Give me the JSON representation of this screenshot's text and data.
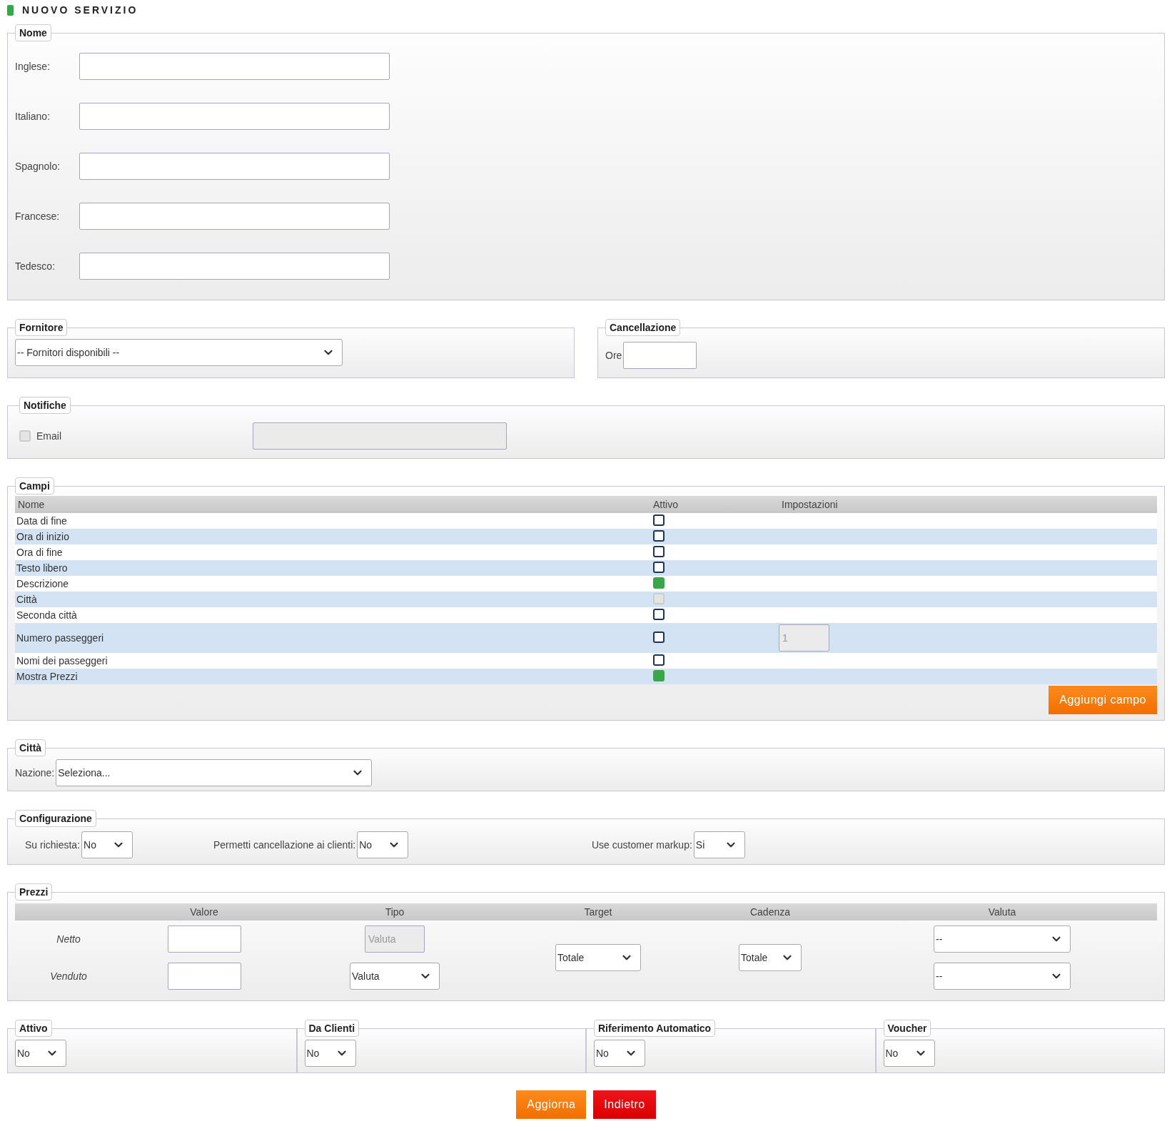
{
  "title": "NUOVO SERVIZIO",
  "nome": {
    "legend": "Nome",
    "fields": [
      {
        "label": "Inglese:"
      },
      {
        "label": "Italiano:"
      },
      {
        "label": "Spagnolo:"
      },
      {
        "label": "Francese:"
      },
      {
        "label": "Tedesco:"
      }
    ]
  },
  "fornitore": {
    "legend": "Fornitore",
    "select": "-- Fornitori disponibili --"
  },
  "cancellazione": {
    "legend": "Cancellazione",
    "label": "Ore"
  },
  "notifiche": {
    "legend": "Notifiche",
    "email": {
      "label": "Email",
      "checked": false,
      "disabled": true
    }
  },
  "campi": {
    "legend": "Campi",
    "columns": [
      "Nome",
      "Attivo",
      "Impostazioni"
    ],
    "rows": [
      {
        "name": "Data di fine",
        "checked": false,
        "disabled": false
      },
      {
        "name": "Ora di inizio",
        "checked": false,
        "disabled": false
      },
      {
        "name": "Ora di fine",
        "checked": false,
        "disabled": false
      },
      {
        "name": "Testo libero",
        "checked": false,
        "disabled": false
      },
      {
        "name": "Descrizione",
        "checked": true,
        "disabled": false
      },
      {
        "name": "Città",
        "checked": false,
        "disabled": true
      },
      {
        "name": "Seconda città",
        "checked": false,
        "disabled": false
      },
      {
        "name": "Numero passeggeri",
        "checked": false,
        "disabled": false,
        "setting": "1"
      },
      {
        "name": "Nomi dei passeggeri",
        "checked": false,
        "disabled": false
      },
      {
        "name": "Mostra Prezzi",
        "checked": true,
        "disabled": false
      }
    ],
    "button": "Aggiungi campo"
  },
  "citta": {
    "legend": "Città",
    "label": "Nazione:",
    "select": "Seleziona..."
  },
  "configurazione": {
    "legend": "Configurazione",
    "items": [
      {
        "label": "Su richiesta:",
        "value": "No"
      },
      {
        "label": "Permetti cancellazione ai clienti:",
        "value": "No"
      },
      {
        "label": "Use customer markup:",
        "value": "Si"
      }
    ]
  },
  "prezzi": {
    "legend": "Prezzi",
    "columns": [
      "Valore",
      "Tipo",
      "Target",
      "Cadenza",
      "Valuta"
    ],
    "rows": [
      {
        "label": "Netto",
        "tipo": "Valuta",
        "tipo_disabled": true,
        "valuta": "--"
      },
      {
        "label": "Venduto",
        "tipo": "Valuta",
        "tipo_disabled": false,
        "valuta": "--"
      }
    ],
    "target": "Totale",
    "cadenza": "Totale"
  },
  "flags": [
    {
      "legend": "Attivo",
      "value": "No"
    },
    {
      "legend": "Da Clienti",
      "value": "No"
    },
    {
      "legend": "Riferimento Automatico",
      "value": "No"
    },
    {
      "legend": "Voucher",
      "value": "No"
    }
  ],
  "buttons": [
    {
      "label": "Aggiorna",
      "kind": "primary"
    },
    {
      "label": "Indietro",
      "kind": "danger"
    }
  ]
}
